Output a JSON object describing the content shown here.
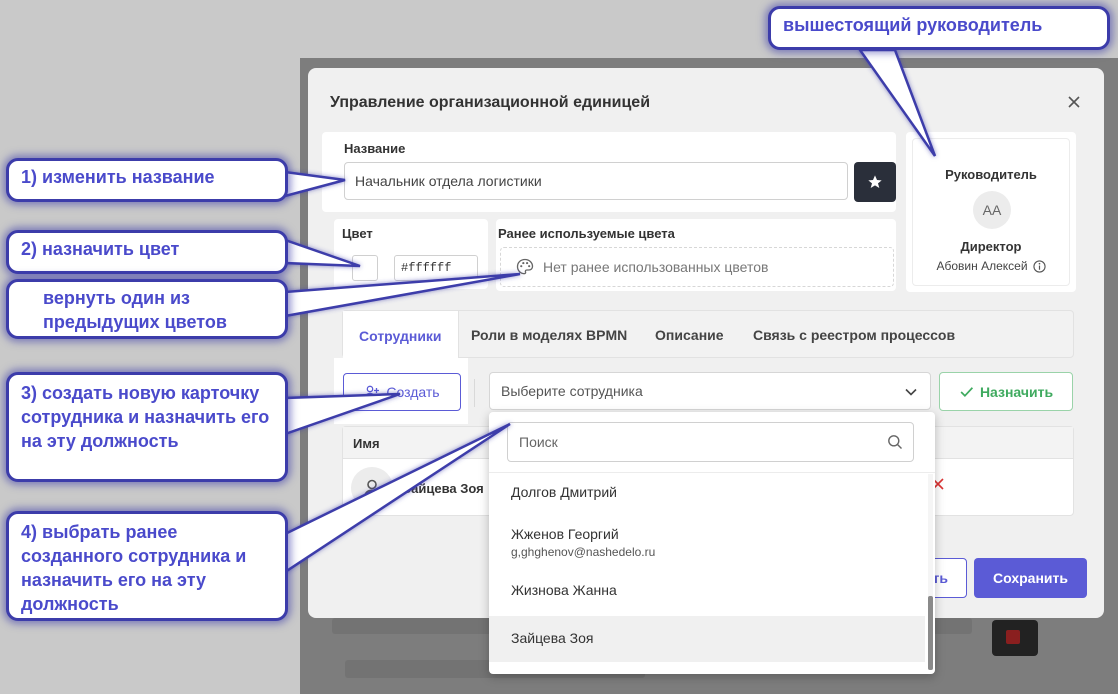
{
  "modal": {
    "title": "Управление организационной единицей",
    "close_icon": "close-icon",
    "name": {
      "label": "Название",
      "value": "Начальник отдела логистики",
      "star_icon": "star-icon"
    },
    "color": {
      "label": "Цвет",
      "swatch": "#ffffff",
      "hex_value": "#ffffff"
    },
    "previous_colors": {
      "label": "Ранее используемые цвета",
      "empty_text": "Нет ранее использованных цветов",
      "icon": "palette-icon"
    },
    "head": {
      "label": "Руководитель",
      "avatar_initials": "АА",
      "role": "Директор",
      "person": "Абовин Алексей",
      "info_icon": "info-icon"
    },
    "tabs": [
      {
        "label": "Сотрудники",
        "active": true
      },
      {
        "label": "Роли в моделях BPMN",
        "active": false
      },
      {
        "label": "Описание",
        "active": false
      },
      {
        "label": "Связь с реестром процессов",
        "active": false
      }
    ],
    "create_button": "Создать",
    "employee_select": {
      "placeholder": "Выберите сотрудника"
    },
    "assign_button": "Назначить",
    "table": {
      "header_name": "Имя",
      "rows": [
        {
          "name": "Зайцева Зоя"
        }
      ]
    },
    "cancel_button": "ть",
    "save_button": "Сохранить"
  },
  "dropdown": {
    "search_placeholder": "Поиск",
    "items": [
      {
        "name": "Долгов Дмитрий",
        "email": ""
      },
      {
        "name": "Жженов Георгий",
        "email": "g,ghghenov@nashedelo.ru"
      },
      {
        "name": "Жизнова Жанна",
        "email": ""
      },
      {
        "name": "Зайцева Зоя",
        "email": "",
        "highlighted": true
      }
    ]
  },
  "callouts": {
    "head": "вышестоящий руководитель",
    "name": "1) изменить название",
    "color": "2) назначить цвет",
    "prev_color": "вернуть один из предыдущих цветов",
    "create": "3) создать новую карточку сотрудника и назначить его на эту должность",
    "select": "4) выбрать ранее созданного сотрудника и назначить его на эту должность"
  },
  "colors": {
    "accent": "#5b5bd6",
    "success": "#3faa5f",
    "danger": "#d33",
    "callout": "#4a4acb"
  }
}
